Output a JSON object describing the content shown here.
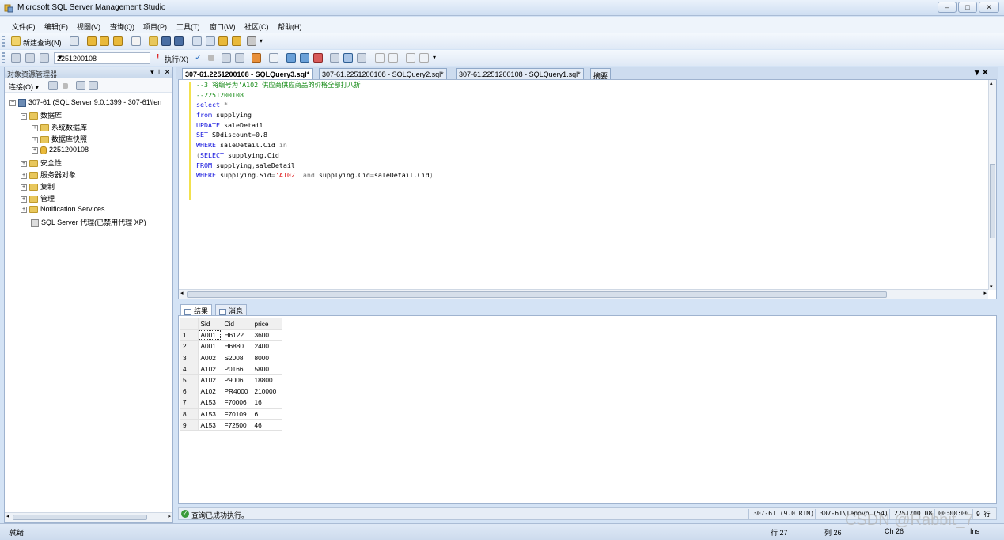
{
  "window": {
    "title": "Microsoft SQL Server Management Studio",
    "btn_min": "–",
    "btn_max": "□",
    "btn_close": "✕"
  },
  "menu": [
    "文件(F)",
    "编辑(E)",
    "视图(V)",
    "查询(Q)",
    "项目(P)",
    "工具(T)",
    "窗口(W)",
    "社区(C)",
    "帮助(H)"
  ],
  "toolbar1": {
    "new_query": "新建查询(N)"
  },
  "toolbar2": {
    "database": "2251200108",
    "execute": "执行(X)"
  },
  "object_explorer": {
    "title": "对象资源管理器",
    "header_buttons": "▾ ⊥ ✕",
    "connect": "连接(O) ▾",
    "tree": {
      "server": "307-61 (SQL Server 9.0.1399 - 307-61\\len",
      "databases": "数据库",
      "system_db": "系统数据库",
      "snapshots": "数据库快照",
      "user_db": "2251200108",
      "security": "安全性",
      "server_objects": "服务器对象",
      "replication": "复制",
      "management": "管理",
      "notification": "Notification Services",
      "agent": "SQL Server 代理(已禁用代理 XP)"
    }
  },
  "tabs": [
    "307-61.2251200108 - SQLQuery3.sql*",
    "307-61.2251200108 - SQLQuery2.sql*",
    "307-61.2251200108 - SQLQuery1.sql*",
    "摘要"
  ],
  "tab_controls": "▾ ✕",
  "editor": {
    "lines": [
      [
        {
          "t": "--3.将编号为'A102'供应商供应商品的价格全部打八折",
          "c": "cm"
        }
      ],
      [
        {
          "t": "--2251200108",
          "c": "cm"
        }
      ],
      [
        {
          "t": "select",
          "c": "kw"
        },
        {
          "t": " *",
          "c": "gr"
        }
      ],
      [
        {
          "t": "from",
          "c": "kw"
        },
        {
          "t": " supplying",
          "c": ""
        }
      ],
      [
        {
          "t": "UPDATE",
          "c": "kw"
        },
        {
          "t": " saleDetail",
          "c": ""
        }
      ],
      [
        {
          "t": "SET",
          "c": "kw"
        },
        {
          "t": " SDdiscount",
          "c": ""
        },
        {
          "t": "=",
          "c": "gr"
        },
        {
          "t": "0.8",
          "c": ""
        }
      ],
      [
        {
          "t": "WHERE",
          "c": "kw"
        },
        {
          "t": " saleDetail.Cid ",
          "c": ""
        },
        {
          "t": "in",
          "c": "gr"
        }
      ],
      [
        {
          "t": "(",
          "c": "gr"
        },
        {
          "t": "SELECT",
          "c": "kw"
        },
        {
          "t": " supplying.Cid",
          "c": ""
        }
      ],
      [
        {
          "t": "FROM",
          "c": "kw"
        },
        {
          "t": " supplying",
          "c": ""
        },
        {
          "t": ",",
          "c": "gr"
        },
        {
          "t": "saleDetail",
          "c": ""
        }
      ],
      [
        {
          "t": "WHERE",
          "c": "kw"
        },
        {
          "t": " supplying.Sid",
          "c": ""
        },
        {
          "t": "=",
          "c": "gr"
        },
        {
          "t": "'A102'",
          "c": "str"
        },
        {
          "t": " and",
          "c": "gr"
        },
        {
          "t": " supplying.Cid",
          "c": ""
        },
        {
          "t": "=",
          "c": "gr"
        },
        {
          "t": "saleDetail.Cid",
          "c": ""
        },
        {
          "t": ")",
          "c": "gr"
        }
      ]
    ]
  },
  "results": {
    "tab_results": "结果",
    "tab_messages": "消息",
    "columns": [
      "Sid",
      "Cid",
      "price"
    ],
    "rows": [
      [
        "1",
        "A001",
        "H6122",
        "3600"
      ],
      [
        "2",
        "A001",
        "H6880",
        "2400"
      ],
      [
        "3",
        "A002",
        "S2008",
        "8000"
      ],
      [
        "4",
        "A102",
        "P0166",
        "5800"
      ],
      [
        "5",
        "A102",
        "P9006",
        "18800"
      ],
      [
        "6",
        "A102",
        "PR4000",
        "210000"
      ],
      [
        "7",
        "A153",
        "F70006",
        "16"
      ],
      [
        "8",
        "A153",
        "F70109",
        "6"
      ],
      [
        "9",
        "A153",
        "F72500",
        "46"
      ]
    ]
  },
  "query_status": {
    "message": "查询已成功执行。",
    "server": "307-61 (9.0 RTM)",
    "user": "307-61\\lenovo (54)",
    "database": "2251200108",
    "time": "00:00:00",
    "rows": "9 行"
  },
  "statusbar": {
    "ready": "就绪",
    "line": "行 27",
    "col": "列 26",
    "ch": "Ch 26",
    "ins": "Ins"
  },
  "watermark": "CSDN @Rabbit_7"
}
